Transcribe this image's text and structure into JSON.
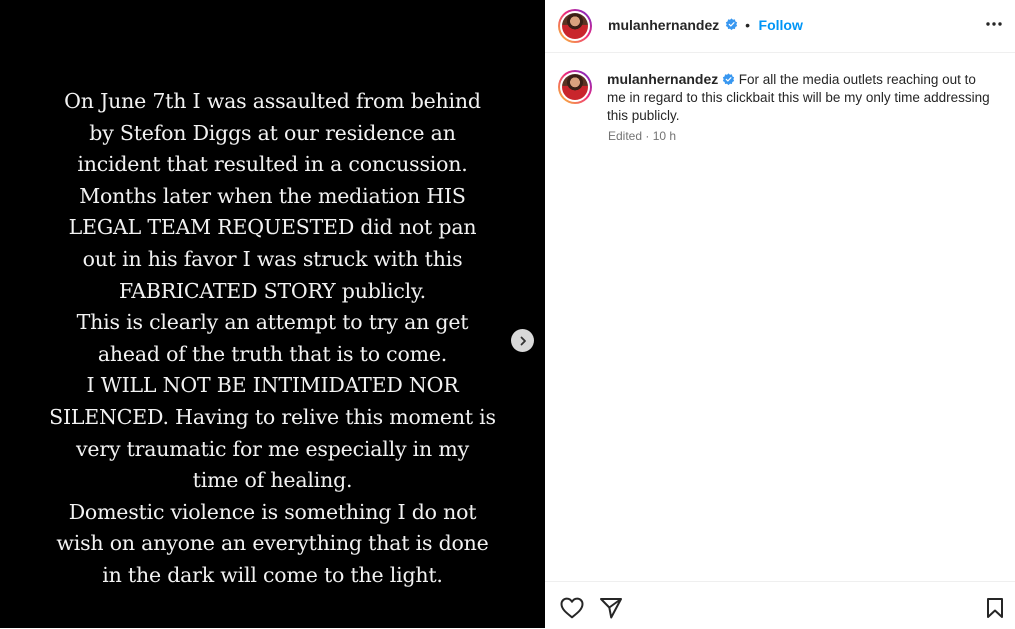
{
  "media": {
    "story_lines": [
      "On June 7th I was assaulted from behind",
      "by Stefon Diggs at our residence an",
      "incident that resulted in a concussion.",
      "Months later when the mediation HIS",
      "LEGAL TEAM REQUESTED did not pan",
      "out in his favor I was struck with this",
      "FABRICATED STORY publicly.",
      "This is clearly an attempt to try an get",
      "ahead of the truth that is to come.",
      "I WILL NOT BE INTIMIDATED NOR",
      "SILENCED. Having to relive this moment is",
      "very traumatic for me especially in my",
      "time of healing.",
      "Domestic violence is something I do not",
      "wish on anyone an everything that is done",
      "in the dark will come to the light."
    ],
    "next_icon": "chevron-right-icon"
  },
  "header": {
    "username": "mulanhernandez",
    "separator": "•",
    "follow_label": "Follow",
    "more_icon": "more-horizontal-icon",
    "verified_icon": "verified-badge-icon"
  },
  "post": {
    "username": "mulanhernandez",
    "caption": "For all the media outlets reaching out to me in regard to this clickbait this will be my only time addressing this publicly.",
    "edited_label": "Edited",
    "meta_separator": "·",
    "time_ago": "10 h"
  },
  "actions": {
    "like_icon": "heart-icon",
    "share_icon": "paper-plane-icon",
    "save_icon": "bookmark-icon"
  },
  "colors": {
    "accent": "#0095f6",
    "verified": "#3897f0",
    "text": "#262626",
    "muted": "#737373",
    "media_bg": "#000000"
  }
}
